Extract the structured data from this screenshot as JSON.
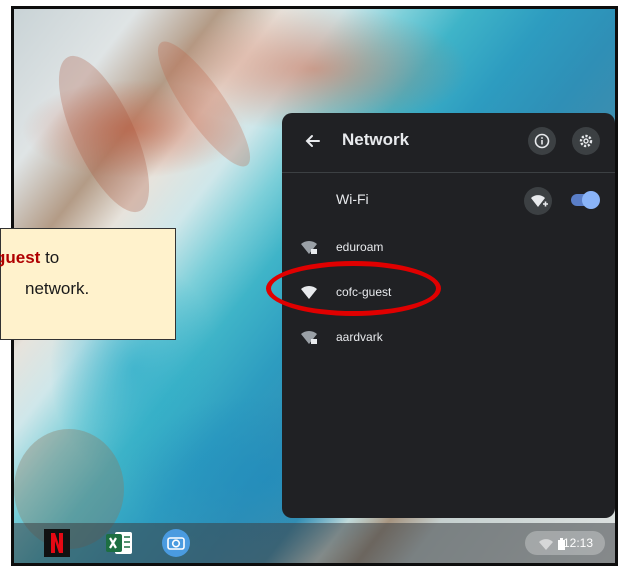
{
  "callout": {
    "line1_bold": "guest",
    "line1_rest": " to",
    "line2": "network."
  },
  "panel": {
    "title": "Network",
    "back_icon": "arrow-left-icon",
    "info_icon": "info-icon",
    "settings_icon": "gear-icon",
    "wifi_label": "Wi-Fi",
    "wifi_enabled": true,
    "networks": [
      {
        "name": "eduroam",
        "locked": true
      },
      {
        "name": "cofc-guest",
        "locked": false
      },
      {
        "name": "aardvark",
        "locked": true
      }
    ]
  },
  "shelf": {
    "apps": [
      "netflix-icon",
      "excel-icon",
      "camera-icon"
    ],
    "time": "12:13"
  },
  "colors": {
    "panel_bg": "#202124",
    "toggle_on": "#8ab4f8",
    "highlight": "#e00000",
    "callout_bg": "#fff2cc",
    "callout_accent": "#b00000"
  }
}
